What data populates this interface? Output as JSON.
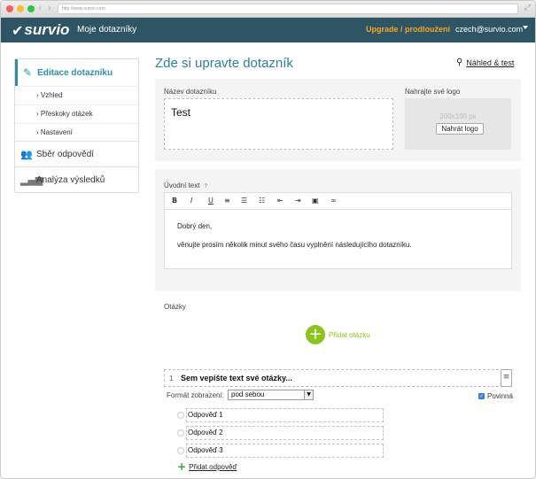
{
  "browser": {
    "url": "http://www.survio.com"
  },
  "appbar": {
    "logo": "survio",
    "nav_title": "Moje dotazníky",
    "upgrade": "Upgrade / prodloužení",
    "user": "czech@survio.com"
  },
  "sidebar": {
    "head": "Editace dotazníku",
    "subitems": [
      {
        "label": "› Vzhled"
      },
      {
        "label": "› Přeskoky otázek"
      },
      {
        "label": "› Nastavení"
      }
    ],
    "items": [
      {
        "label": "Sběr odpovědí",
        "icon": "users-icon"
      },
      {
        "label": "Analýza výsledků",
        "icon": "bar-chart-icon"
      }
    ]
  },
  "main": {
    "title": "Zde si upravte dotazník",
    "preview_label": "Náhled & test",
    "name_label": "Název dotazníku",
    "name_value": "Test",
    "logo_label": "Nahrajte své logo",
    "logo_dim": "200x100 px",
    "logo_button": "Nahrát logo",
    "intro_label": "Úvodní text",
    "help": "?",
    "toolbar": [
      "B",
      "I",
      "U",
      "align-left",
      "bulleted-list",
      "numbered-list",
      "outdent",
      "indent",
      "image",
      "link"
    ],
    "intro_paragraphs": [
      "Dobrý den,",
      "věnujte prosím několik minut svého času vyplnění následujícího dotazníku."
    ],
    "questions_label": "Otázky",
    "add_question": "Přidat otázku",
    "question": {
      "number": "1",
      "text": "Sem vepište text své otázky...",
      "format_label": "Formát zobrazení:",
      "format_value": "pod sebou",
      "required_label": "Povinná",
      "required": true,
      "answers": [
        "Odpověď 1",
        "Odpověď 2",
        "Odpověď 3"
      ],
      "add_answer": "Přidat odpověď"
    }
  }
}
